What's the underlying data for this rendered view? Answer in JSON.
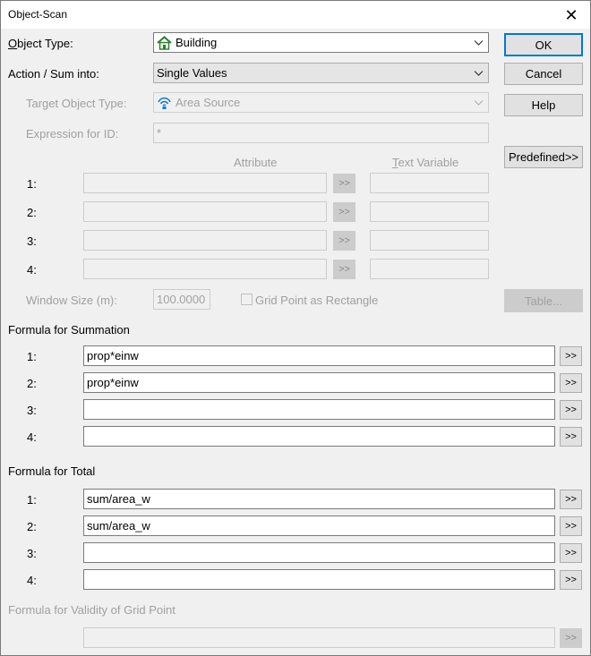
{
  "window": {
    "title": "Object-Scan"
  },
  "object_type": {
    "label_first": "O",
    "label_rest": "bject Type:",
    "value": "Building"
  },
  "action": {
    "label": "Action / Sum into:",
    "value": "Single Values"
  },
  "target_object_type": {
    "label": "Target Object Type:",
    "value": "Area Source"
  },
  "expression_id": {
    "label": "Expression for ID:",
    "value": "*"
  },
  "attributes": {
    "attribute_header": "Attribute",
    "textvar_header_first": "T",
    "textvar_header_rest": "ext Variable",
    "rows": [
      {
        "num": "1:",
        "attribute": "",
        "text_variable": "",
        "arrow": ">>"
      },
      {
        "num": "2:",
        "attribute": "",
        "text_variable": "",
        "arrow": ">>"
      },
      {
        "num": "3:",
        "attribute": "",
        "text_variable": "",
        "arrow": ">>"
      },
      {
        "num": "4:",
        "attribute": "",
        "text_variable": "",
        "arrow": ">>"
      }
    ]
  },
  "window_size": {
    "label": "Window Size (m):",
    "value": "100.0000"
  },
  "grid_point_rect": {
    "label": "Grid Point as Rectangle",
    "checked": false
  },
  "buttons": {
    "ok": "OK",
    "cancel": "Cancel",
    "help": "Help",
    "predefined": "Predefined>>",
    "table": "Table..."
  },
  "summation": {
    "title": "Formula for Summation",
    "rows": [
      {
        "num": "1:",
        "value": "prop*einw",
        "arrow": ">>"
      },
      {
        "num": "2:",
        "value": "prop*einw",
        "arrow": ">>"
      },
      {
        "num": "3:",
        "value": "",
        "arrow": ">>"
      },
      {
        "num": "4:",
        "value": "",
        "arrow": ">>"
      }
    ]
  },
  "total": {
    "title": "Formula for Total",
    "rows": [
      {
        "num": "1:",
        "value": "sum/area_w",
        "arrow": ">>"
      },
      {
        "num": "2:",
        "value": "sum/area_w",
        "arrow": ">>"
      },
      {
        "num": "3:",
        "value": "",
        "arrow": ">>"
      },
      {
        "num": "4:",
        "value": "",
        "arrow": ">>"
      }
    ]
  },
  "validity": {
    "title": "Formula for Validity of Grid Point",
    "value": "",
    "arrow": ">>"
  }
}
